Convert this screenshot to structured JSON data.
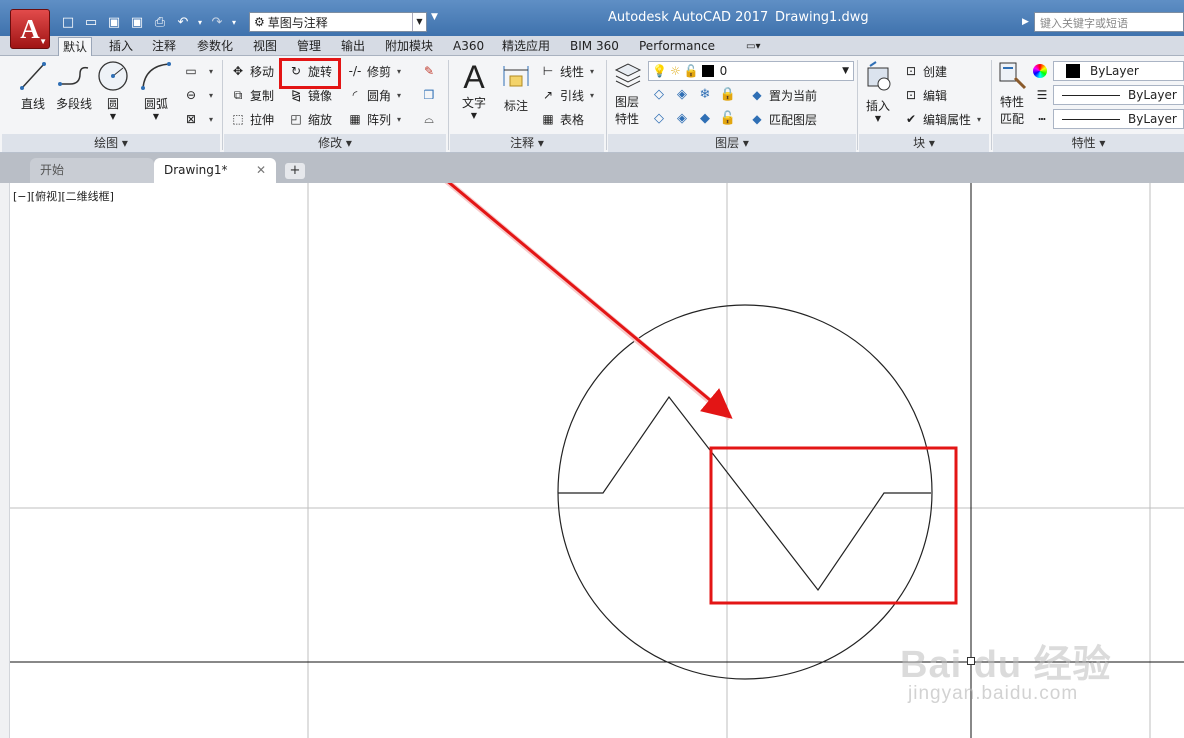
{
  "titlebar": {
    "app_title": "Autodesk AutoCAD 2017",
    "doc_title": "Drawing1.dwg",
    "workspace": "草图与注释",
    "search_placeholder": "键入关键字或短语",
    "logo_letter": "A"
  },
  "menu_tabs": [
    {
      "label": "默认",
      "active": true
    },
    {
      "label": "插入"
    },
    {
      "label": "注释"
    },
    {
      "label": "参数化"
    },
    {
      "label": "视图"
    },
    {
      "label": "管理"
    },
    {
      "label": "输出"
    },
    {
      "label": "附加模块"
    },
    {
      "label": "A360"
    },
    {
      "label": "精选应用"
    },
    {
      "label": "BIM 360"
    },
    {
      "label": "Performance"
    }
  ],
  "ribbon": {
    "draw": {
      "line": "直线",
      "polyline": "多段线",
      "circle": "圆",
      "arc": "圆弧",
      "footer": "绘图"
    },
    "modify": {
      "move": "移动",
      "rotate": "旋转",
      "trim": "修剪",
      "copy": "复制",
      "mirror": "镜像",
      "fillet": "圆角",
      "stretch": "拉伸",
      "scale": "缩放",
      "array": "阵列",
      "footer": "修改"
    },
    "annotation": {
      "text": "文字",
      "dimension": "标注",
      "linear": "线性",
      "leader": "引线",
      "table": "表格",
      "footer": "注释"
    },
    "layers": {
      "layer_properties_1": "图层",
      "layer_properties_2": "特性",
      "current_layer": "0",
      "set_current": "置为当前",
      "match_layer": "匹配图层",
      "footer": "图层"
    },
    "block": {
      "insert": "插入",
      "create": "创建",
      "edit": "编辑",
      "edit_attributes": "编辑属性",
      "footer": "块"
    },
    "properties": {
      "match_1": "特性",
      "match_2": "匹配",
      "color": "ByLayer",
      "lineweight": "ByLayer",
      "linetype": "ByLayer",
      "footer": "特性"
    }
  },
  "file_tabs": {
    "start": "开始",
    "drawing": "Drawing1*",
    "close": "✕",
    "add": "+"
  },
  "viewport": {
    "label": "[−][俯视][二维线框]"
  },
  "watermark": {
    "line1": "Bai du 经验",
    "line2": "jingyan.baidu.com"
  },
  "colors": {
    "highlight": "#e31515",
    "arrow": "#e31515",
    "title_bar": "#4a7cb5"
  }
}
